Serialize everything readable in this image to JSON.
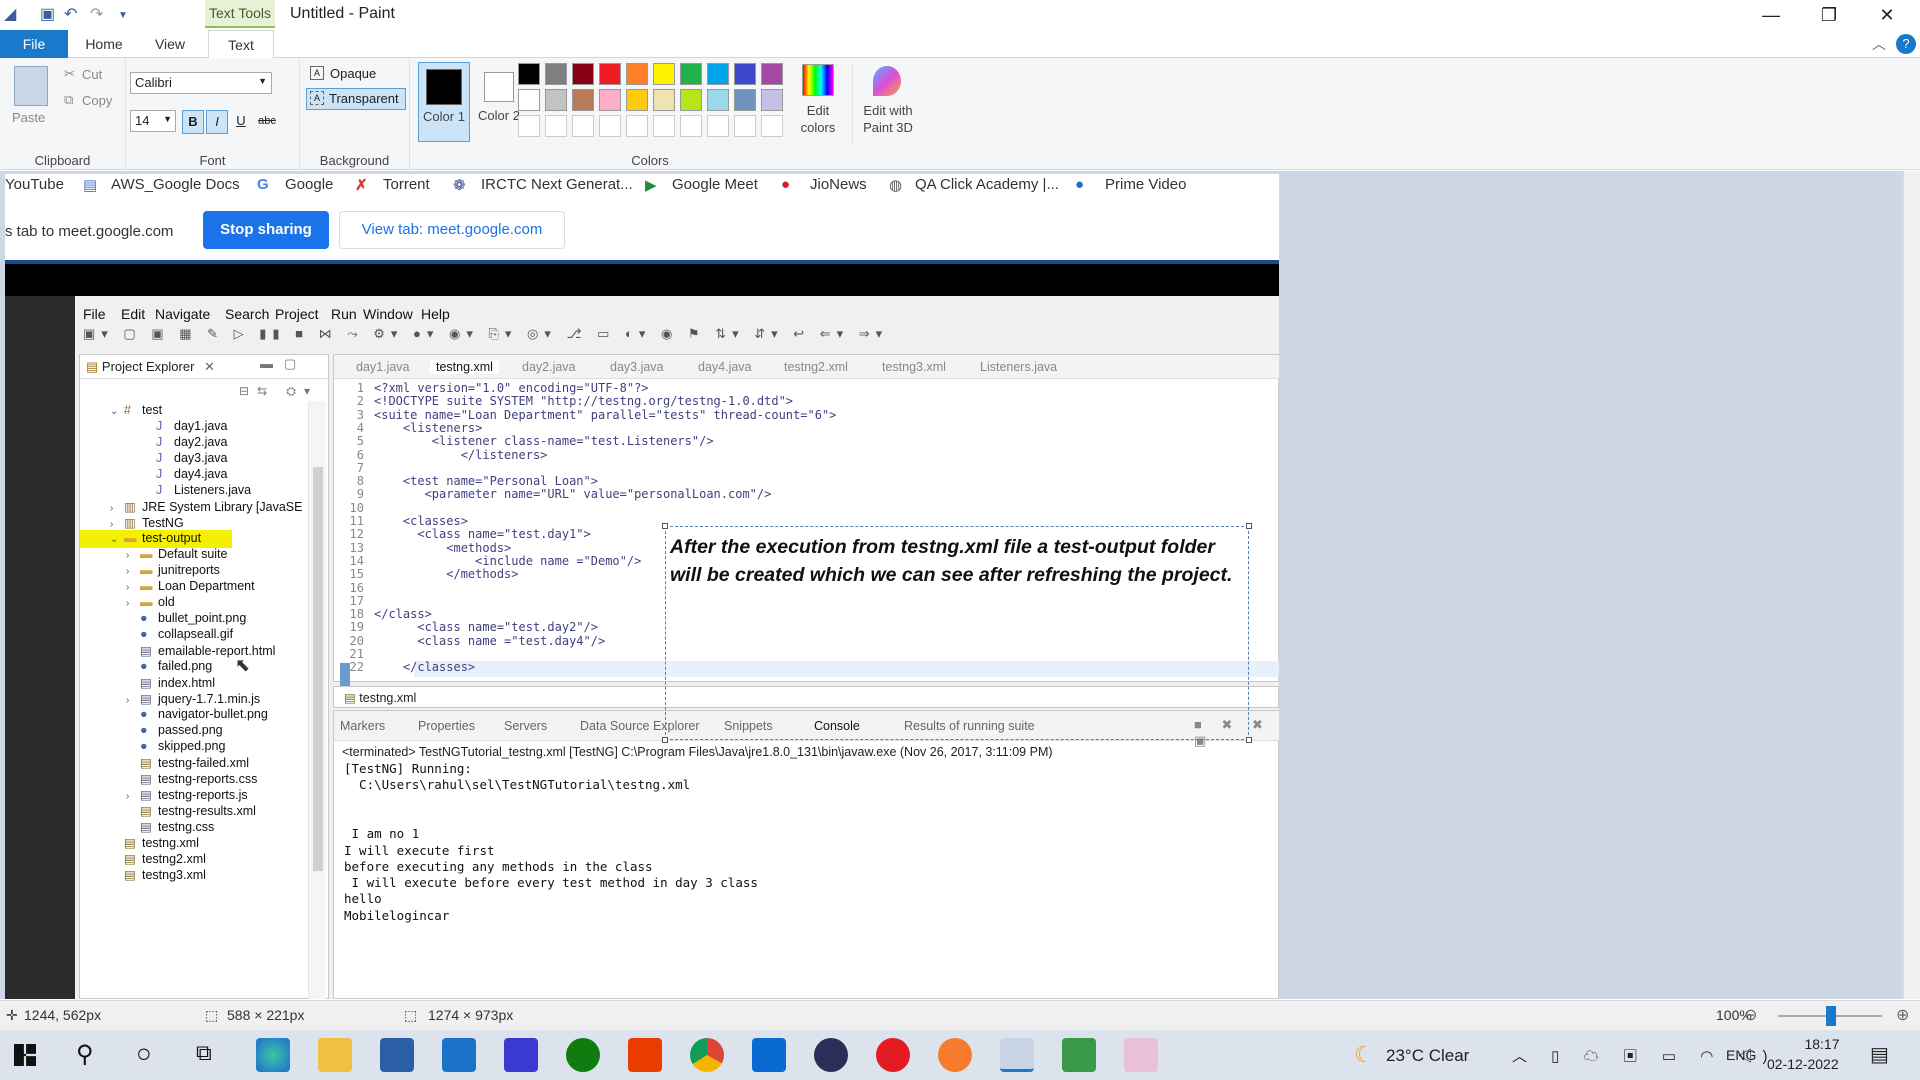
{
  "window": {
    "title": "Untitled - Paint",
    "context_tab": "Text Tools"
  },
  "ribbon_tabs": [
    "File",
    "Home",
    "View",
    "Text"
  ],
  "clipboard": {
    "paste": "Paste",
    "cut": "Cut",
    "copy": "Copy",
    "label": "Clipboard"
  },
  "font": {
    "family": "Calibri",
    "size": "14",
    "label": "Font",
    "bold": "B",
    "italic": "I",
    "underline": "U",
    "strike": "abc"
  },
  "background": {
    "opaque": "Opaque",
    "transparent": "Transparent",
    "label": "Background"
  },
  "colors": {
    "color1": "Color 1",
    "color2": "Color 2",
    "edit": "Edit colors",
    "paint3d": "Edit with Paint 3D",
    "label": "Colors",
    "row1": [
      "#000000",
      "#7f7f7f",
      "#880015",
      "#ed1c24",
      "#ff7f27",
      "#fff200",
      "#22b14c",
      "#00a2e8",
      "#3f48cc",
      "#a349a4"
    ],
    "row2": [
      "#ffffff",
      "#c3c3c3",
      "#b97a57",
      "#ffaec9",
      "#ffc90e",
      "#efe4b0",
      "#b5e61d",
      "#99d9ea",
      "#7092be",
      "#c8bfe7"
    ]
  },
  "bookmarks": [
    "YouTube",
    "AWS_Google Docs",
    "Google",
    "Torrent",
    "IRCTC Next Generat...",
    "Google Meet",
    "JioNews",
    "QA Click Academy |...",
    "Prime Video"
  ],
  "share": {
    "text": "s tab to meet.google.com",
    "stop": "Stop sharing",
    "view": "View tab: meet.google.com"
  },
  "eclipse": {
    "menu": [
      "File",
      "Edit",
      "Navigate",
      "Search",
      "Project",
      "Run",
      "Window",
      "Help"
    ],
    "explorer_title": "Project Explorer",
    "tree": [
      {
        "label": "test",
        "indent": 1
      },
      {
        "label": "day1.java",
        "indent": 3
      },
      {
        "label": "day2.java",
        "indent": 3
      },
      {
        "label": "day3.java",
        "indent": 3
      },
      {
        "label": "day4.java",
        "indent": 3
      },
      {
        "label": "Listeners.java",
        "indent": 3
      },
      {
        "label": "JRE System Library [JavaSE",
        "indent": 1
      },
      {
        "label": "TestNG",
        "indent": 1
      },
      {
        "label": "test-output",
        "indent": 1
      },
      {
        "label": "Default suite",
        "indent": 2
      },
      {
        "label": "junitreports",
        "indent": 2
      },
      {
        "label": "Loan Department",
        "indent": 2
      },
      {
        "label": "old",
        "indent": 2
      },
      {
        "label": "bullet_point.png",
        "indent": 2
      },
      {
        "label": "collapseall.gif",
        "indent": 2
      },
      {
        "label": "emailable-report.html",
        "indent": 2
      },
      {
        "label": "failed.png",
        "indent": 2
      },
      {
        "label": "index.html",
        "indent": 2
      },
      {
        "label": "jquery-1.7.1.min.js",
        "indent": 2
      },
      {
        "label": "navigator-bullet.png",
        "indent": 2
      },
      {
        "label": "passed.png",
        "indent": 2
      },
      {
        "label": "skipped.png",
        "indent": 2
      },
      {
        "label": "testng-failed.xml",
        "indent": 2
      },
      {
        "label": "testng-reports.css",
        "indent": 2
      },
      {
        "label": "testng-reports.js",
        "indent": 2
      },
      {
        "label": "testng-results.xml",
        "indent": 2
      },
      {
        "label": "testng.css",
        "indent": 2
      },
      {
        "label": "testng.xml",
        "indent": 1
      },
      {
        "label": "testng2.xml",
        "indent": 1
      },
      {
        "label": "testng3.xml",
        "indent": 1
      }
    ],
    "editor_tabs": [
      "day1.java",
      "testng.xml",
      "day2.java",
      "day3.java",
      "day4.java",
      "testng2.xml",
      "testng3.xml",
      "Listeners.java"
    ],
    "code": [
      "<?xml version=\"1.0\" encoding=\"UTF-8\"?>",
      "<!DOCTYPE suite SYSTEM \"http://testng.org/testng-1.0.dtd\">",
      "<suite name=\"Loan Department\" parallel=\"tests\" thread-count=\"6\">",
      "    <listeners>",
      "        <listener class-name=\"test.Listeners\"/>",
      "            </listeners>",
      "",
      "    <test name=\"Personal Loan\">",
      "       <parameter name=\"URL\" value=\"personalLoan.com\"/>",
      "",
      "    <classes>",
      "      <class name=\"test.day1\">",
      "          <methods>",
      "              <include name =\"Demo\"/>",
      "          </methods>",
      "",
      "",
      "</class>",
      "      <class name=\"test.day2\"/>",
      "      <class name =\"test.day4\"/>",
      "",
      "    </classes>"
    ],
    "file_tab": "testng.xml",
    "bottom_tabs": [
      "Markers",
      "Properties",
      "Servers",
      "Data Source Explorer",
      "Snippets",
      "Console",
      "Results of running suite"
    ],
    "console_header": "<terminated> TestNGTutorial_testng.xml [TestNG] C:\\Program Files\\Java\\jre1.8.0_131\\bin\\javaw.exe (Nov 26, 2017, 3:11:09 PM)",
    "console": [
      "[TestNG] Running:",
      "  C:\\Users\\rahul\\sel\\TestNGTutorial\\testng.xml",
      "",
      "",
      " I am no 1",
      "I will execute first",
      "before executing any methods in the class",
      " I will execute before every test method in day 3 class",
      "hello",
      "Mobilelogincar"
    ]
  },
  "annotation": [
    "After the execution from testng.xml file a test-output folder",
    "will be created which we can see after refreshing the project."
  ],
  "status": {
    "cursor": "1244, 562px",
    "selection": "588 × 221px",
    "size": "1274 × 973px",
    "zoom": "100%"
  },
  "taskbar": {
    "weather": "23°C  Clear",
    "lang": "ENG",
    "time": "18:17",
    "date": "02-12-2022"
  }
}
